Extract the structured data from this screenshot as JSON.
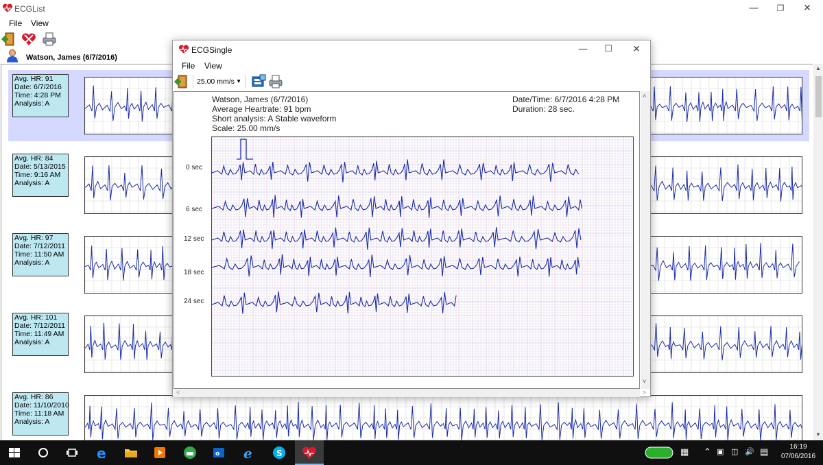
{
  "main_window": {
    "title": "ECGList",
    "menu": [
      "File",
      "View"
    ],
    "patient_label": "Watson, James (6/7/2016)",
    "records": [
      {
        "avg_hr": "Avg. HR: 91",
        "date": "Date: 6/7/2016",
        "time": "Time: 4:28 PM",
        "analysis": "Analysis: A",
        "selected": true
      },
      {
        "avg_hr": "Avg. HR: 84",
        "date": "Date: 5/13/2015",
        "time": "Time: 9:16 AM",
        "analysis": "Analysis: A",
        "selected": false
      },
      {
        "avg_hr": "Avg. HR: 97",
        "date": "Date: 7/12/2011",
        "time": "Time: 11:50 AM",
        "analysis": "Analysis: A",
        "selected": false
      },
      {
        "avg_hr": "Avg. HR: 101",
        "date": "Date: 7/12/2011",
        "time": "Time: 11:49 AM",
        "analysis": "Analysis: A",
        "selected": false
      },
      {
        "avg_hr": "Avg. HR: 86",
        "date": "Date: 11/10/2010",
        "time": "Time: 11:18 AM",
        "analysis": "Analysis: A",
        "selected": false
      }
    ]
  },
  "single_window": {
    "title": "ECGSingle",
    "menu": [
      "File",
      "View"
    ],
    "speed": "25.00 mm/s",
    "patient": "Watson, James (6/7/2016)",
    "average_hr": "Average Heartrate: 91 bpm",
    "short_analysis": "Short analysis: A Stable waveform",
    "scale": "Scale: 25.00 mm/s",
    "datetime": "Date/Time: 6/7/2016 4:28 PM",
    "duration": "Duration: 28 sec.",
    "time_labels": [
      "0 sec",
      "6 sec",
      "12 sec",
      "18 sec",
      "24 sec"
    ]
  },
  "taskbar": {
    "time": "16:19",
    "date": "07/06/2016"
  },
  "colors": {
    "selection": "#d6d9ff",
    "info_box": "#bde8f2",
    "trace": "#1a2aa8",
    "grid_red": "#f2b8c6",
    "grid_blue": "#b9c8f0"
  }
}
